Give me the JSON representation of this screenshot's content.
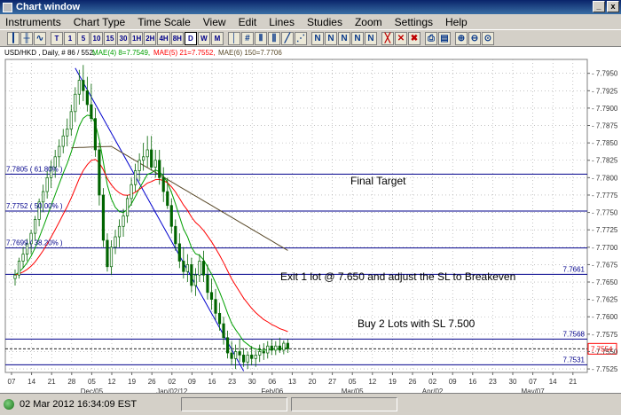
{
  "window": {
    "title": "Chart window",
    "btn_minimize": "_",
    "btn_close": "x"
  },
  "menu": [
    "Instruments",
    "Chart Type",
    "Time Scale",
    "View",
    "Edit",
    "Lines",
    "Studies",
    "Zoom",
    "Settings",
    "Help"
  ],
  "toolbar": {
    "timeframes": [
      "T",
      "1",
      "5",
      "10",
      "15",
      "30",
      "1H",
      "2H",
      "4H",
      "8H",
      "D",
      "W",
      "M"
    ],
    "selected": "D"
  },
  "legend": {
    "symbol": "USD/HKD , Daily, # 86 / 552,",
    "mae4": "MAE(4) 8=7.7549,",
    "mae5": "MAE(5) 21=7.7552,",
    "mae6": "MAE(6) 150=7.7706"
  },
  "colors": {
    "candle": "#006400",
    "mae4": "#00a000",
    "mae5": "#ff0000",
    "mae6": "#5a4a2a",
    "level": "#00008b",
    "trend": "#0000cd",
    "price_tag": "#ff0000",
    "axis_text": "#333333"
  },
  "chart_data": {
    "type": "candlestick",
    "ylim": [
      7.752,
      7.797
    ],
    "y_ticks": [
      "7.7950",
      "7.7925",
      "7.7900",
      "7.7875",
      "7.7850",
      "7.7825",
      "7.7800",
      "7.7775",
      "7.7750",
      "7.7725",
      "7.7700",
      "7.7675",
      "7.7650",
      "7.7625",
      "7.7600",
      "7.7575",
      "7.7550",
      "7.7525"
    ],
    "x_ticks": [
      "07",
      "14",
      "21",
      "28",
      "05",
      "12",
      "19",
      "26",
      "02",
      "09",
      "16",
      "23",
      "30",
      "06",
      "13",
      "20",
      "27",
      "05",
      "12",
      "19",
      "26",
      "02",
      "09",
      "16",
      "23",
      "30",
      "07",
      "14",
      "21"
    ],
    "month_labels": [
      {
        "label": "Dec/05",
        "tick": "05"
      },
      {
        "label": "Jan/02/12",
        "tick": "02"
      },
      {
        "label": "Feb/06",
        "tick": "06"
      },
      {
        "label": "Mar/05",
        "tick": "05"
      },
      {
        "label": "Apr/02",
        "tick": "02"
      },
      {
        "label": "May/07",
        "tick": "07"
      }
    ],
    "levels": [
      {
        "price": 7.7805,
        "label": "7.7805 ( 61.80% )",
        "side": "left"
      },
      {
        "price": 7.7752,
        "label": "7.7752 ( 50.00% )",
        "side": "left"
      },
      {
        "price": 7.7699,
        "label": "7.7699 ( 38.20% )",
        "side": "left"
      },
      {
        "price": 7.7661,
        "label": "7.7661",
        "side": "right"
      },
      {
        "price": 7.7568,
        "label": "7.7568",
        "side": "right"
      },
      {
        "price": 7.7531,
        "label": "7.7531",
        "side": "right"
      }
    ],
    "current_price": "7.7554",
    "current_value": 7.7554,
    "annotations": [
      "Final Target",
      "Exit 1 lot @ 7.650 and adjust the SL to Breakeven",
      "Buy 2 Lots  with SL 7.500"
    ],
    "candles": [
      [
        7.7655,
        7.7668,
        7.7645,
        7.766
      ],
      [
        7.766,
        7.7685,
        7.7655,
        7.768
      ],
      [
        7.768,
        7.77,
        7.767,
        7.769
      ],
      [
        7.769,
        7.7712,
        7.768,
        7.7705
      ],
      [
        7.7705,
        7.7725,
        7.769,
        7.772
      ],
      [
        7.772,
        7.7745,
        7.771,
        7.774
      ],
      [
        7.774,
        7.777,
        7.773,
        7.7765
      ],
      [
        7.7765,
        7.779,
        7.775,
        7.778
      ],
      [
        7.778,
        7.781,
        7.777,
        7.78
      ],
      [
        7.78,
        7.7825,
        7.7785,
        7.7815
      ],
      [
        7.7815,
        7.784,
        7.78,
        7.783
      ],
      [
        7.783,
        7.7855,
        7.7815,
        7.7845
      ],
      [
        7.7845,
        7.787,
        7.7835,
        7.786
      ],
      [
        7.786,
        7.7885,
        7.7845,
        7.787
      ],
      [
        7.787,
        7.7905,
        7.786,
        7.7895
      ],
      [
        7.7895,
        7.793,
        7.788,
        7.792
      ],
      [
        7.792,
        7.7955,
        7.7905,
        7.794
      ],
      [
        7.794,
        7.7962,
        7.791,
        7.7925
      ],
      [
        7.7925,
        7.7945,
        7.7895,
        7.7905
      ],
      [
        7.7905,
        7.7935,
        7.788,
        7.7885
      ],
      [
        7.7885,
        7.79,
        7.783,
        7.784
      ],
      [
        7.784,
        7.785,
        7.776,
        7.7775
      ],
      [
        7.7775,
        7.7785,
        7.77,
        7.771
      ],
      [
        7.771,
        7.772,
        7.7665,
        7.7672
      ],
      [
        7.7672,
        7.771,
        7.766,
        7.77
      ],
      [
        7.77,
        7.7725,
        7.769,
        7.7715
      ],
      [
        7.7715,
        7.774,
        7.77,
        7.773
      ],
      [
        7.773,
        7.7755,
        7.7715,
        7.7745
      ],
      [
        7.7745,
        7.7775,
        7.7735,
        7.777
      ],
      [
        7.777,
        7.78,
        7.776,
        7.779
      ],
      [
        7.779,
        7.782,
        7.778,
        7.781
      ],
      [
        7.781,
        7.7835,
        7.7795,
        7.7825
      ],
      [
        7.7825,
        7.785,
        7.781,
        7.783
      ],
      [
        7.783,
        7.786,
        7.7815,
        7.784
      ],
      [
        7.784,
        7.786,
        7.781,
        7.7815
      ],
      [
        7.7815,
        7.784,
        7.78,
        7.7825
      ],
      [
        7.7825,
        7.784,
        7.779,
        7.78
      ],
      [
        7.78,
        7.7815,
        7.7765,
        7.778
      ],
      [
        7.778,
        7.78,
        7.7755,
        7.776
      ],
      [
        7.776,
        7.777,
        7.772,
        7.773
      ],
      [
        7.773,
        7.774,
        7.7695,
        7.7705
      ],
      [
        7.7705,
        7.772,
        7.767,
        7.768
      ],
      [
        7.768,
        7.77,
        7.7655,
        7.7665
      ],
      [
        7.7665,
        7.769,
        7.765,
        7.7675
      ],
      [
        7.7675,
        7.7685,
        7.7635,
        7.7645
      ],
      [
        7.7645,
        7.767,
        7.763,
        7.766
      ],
      [
        7.766,
        7.769,
        7.765,
        7.768
      ],
      [
        7.768,
        7.7695,
        7.765,
        7.766
      ],
      [
        7.766,
        7.7675,
        7.7625,
        7.7635
      ],
      [
        7.7635,
        7.7655,
        7.761,
        7.7625
      ],
      [
        7.7625,
        7.764,
        7.7595,
        7.7605
      ],
      [
        7.7605,
        7.762,
        7.758,
        7.759
      ],
      [
        7.759,
        7.76,
        7.756,
        7.757
      ],
      [
        7.757,
        7.758,
        7.754,
        7.7548
      ],
      [
        7.7548,
        7.7565,
        7.753,
        7.754
      ],
      [
        7.754,
        7.756,
        7.7525,
        7.755
      ],
      [
        7.755,
        7.7568,
        7.7535,
        7.7545
      ],
      [
        7.7545,
        7.7555,
        7.7528,
        7.7535
      ],
      [
        7.7535,
        7.755,
        7.7525,
        7.7545
      ],
      [
        7.7545,
        7.7558,
        7.753,
        7.754
      ],
      [
        7.754,
        7.7552,
        7.7528,
        7.7545
      ],
      [
        7.7545,
        7.756,
        7.7535,
        7.755
      ],
      [
        7.755,
        7.7562,
        7.7538,
        7.7548
      ],
      [
        7.7548,
        7.7565,
        7.754,
        7.7558
      ],
      [
        7.7558,
        7.7568,
        7.7545,
        7.7552
      ],
      [
        7.7552,
        7.7565,
        7.7545,
        7.7558
      ],
      [
        7.7558,
        7.757,
        7.7548,
        7.7552
      ],
      [
        7.7552,
        7.7566,
        7.7546,
        7.7562
      ],
      [
        7.7562,
        7.7568,
        7.7548,
        7.7554
      ]
    ]
  },
  "status": {
    "datetime": "02 Mar 2012 16:34:09 EST"
  }
}
